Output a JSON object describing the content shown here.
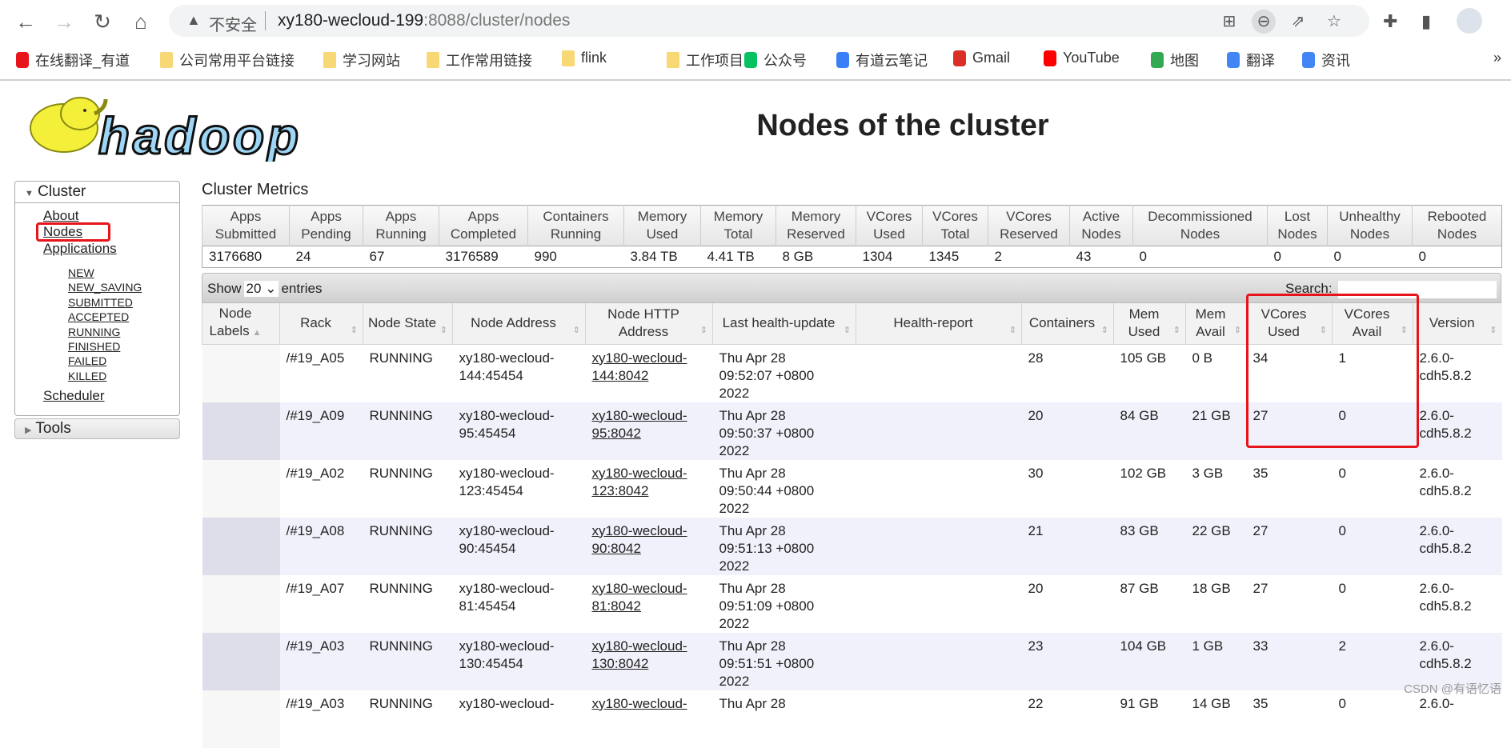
{
  "browser": {
    "insecure_label": "不安全",
    "url_host": "xy180-wecloud-199",
    "url_rest": ":8088/cluster/nodes",
    "bookmarks": [
      {
        "label": "在线翻译_有道",
        "icon": "youdao-icon",
        "color": "#e8141c"
      },
      {
        "label": "公司常用平台链接",
        "icon": "folder-icon",
        "color": "#f8d775"
      },
      {
        "label": "学习网站",
        "icon": "folder-icon",
        "color": "#f8d775"
      },
      {
        "label": "工作常用链接",
        "icon": "folder-icon",
        "color": "#f8d775"
      },
      {
        "label": "flink",
        "icon": "folder-icon",
        "color": "#f8d775"
      },
      {
        "label": "工作项目",
        "icon": "folder-icon",
        "color": "#f8d775"
      },
      {
        "label": "公众号",
        "icon": "wechat-icon",
        "color": "#07c160"
      },
      {
        "label": "有道云笔记",
        "icon": "youdao-note-icon",
        "color": "#3a7ff6"
      },
      {
        "label": "Gmail",
        "icon": "gmail-icon",
        "color": "#d93025"
      },
      {
        "label": "YouTube",
        "icon": "youtube-icon",
        "color": "#ff0000"
      },
      {
        "label": "地图",
        "icon": "maps-icon",
        "color": "#34a853"
      },
      {
        "label": "翻译",
        "icon": "translate-icon",
        "color": "#4285f4"
      },
      {
        "label": "资讯",
        "icon": "news-icon",
        "color": "#4285f4"
      }
    ],
    "more": "»"
  },
  "logo": {
    "text": "hadoop"
  },
  "page_title": "Nodes of the cluster",
  "sidebar": {
    "cluster_label": "Cluster",
    "links": [
      "About",
      "Nodes",
      "Applications"
    ],
    "app_states": [
      "NEW",
      "NEW_SAVING",
      "SUBMITTED",
      "ACCEPTED",
      "RUNNING",
      "FINISHED",
      "FAILED",
      "KILLED"
    ],
    "scheduler": "Scheduler",
    "tools_label": "Tools"
  },
  "metrics": {
    "title": "Cluster Metrics",
    "headers": [
      [
        "Apps",
        "Submitted"
      ],
      [
        "Apps",
        "Pending"
      ],
      [
        "Apps",
        "Running"
      ],
      [
        "Apps",
        "Completed"
      ],
      [
        "Containers",
        "Running"
      ],
      [
        "Memory",
        "Used"
      ],
      [
        "Memory",
        "Total"
      ],
      [
        "Memory",
        "Reserved"
      ],
      [
        "VCores",
        "Used"
      ],
      [
        "VCores",
        "Total"
      ],
      [
        "VCores",
        "Reserved"
      ],
      [
        "Active",
        "Nodes"
      ],
      [
        "Decommissioned",
        "Nodes"
      ],
      [
        "Lost",
        "Nodes"
      ],
      [
        "Unhealthy",
        "Nodes"
      ],
      [
        "Rebooted",
        "Nodes"
      ]
    ],
    "values": [
      "3176680",
      "24",
      "67",
      "3176589",
      "990",
      "3.84 TB",
      "4.41 TB",
      "8 GB",
      "1304",
      "1345",
      "2",
      "43",
      "0",
      "0",
      "0",
      "0"
    ],
    "linked": [
      false,
      false,
      false,
      false,
      false,
      false,
      false,
      false,
      false,
      false,
      false,
      true,
      true,
      true,
      true,
      true
    ]
  },
  "datatable": {
    "show_label": "Show",
    "entries_value": "20",
    "entries_label": "entries",
    "search_label": "Search:",
    "search_value": ""
  },
  "nodes": {
    "headers": [
      [
        "Node",
        "Labels"
      ],
      [
        "Rack"
      ],
      [
        "Node State"
      ],
      [
        "Node Address"
      ],
      [
        "Node HTTP",
        "Address"
      ],
      [
        "Last health-update"
      ],
      [
        "Health-report"
      ],
      [
        "Containers"
      ],
      [
        "Mem",
        "Used"
      ],
      [
        "Mem",
        "Avail"
      ],
      [
        "VCores",
        "Used"
      ],
      [
        "VCores",
        "Avail"
      ],
      [
        "Version"
      ]
    ],
    "sorted_column": "Node Labels",
    "rows": [
      {
        "labels": "",
        "rack": "/#19_A05",
        "state": "RUNNING",
        "address": [
          "xy180-wecloud-",
          "144:45454"
        ],
        "http": [
          "xy180-wecloud-",
          "144:8042"
        ],
        "health_update": [
          "Thu Apr 28",
          "09:52:07 +0800",
          "2022"
        ],
        "health_report": "",
        "containers": "28",
        "mem_used": "105 GB",
        "mem_avail": "0 B",
        "vcores_used": "34",
        "vcores_avail": "1",
        "version": [
          "2.6.0-",
          "cdh5.8.2"
        ]
      },
      {
        "labels": "",
        "rack": "/#19_A09",
        "state": "RUNNING",
        "address": [
          "xy180-wecloud-",
          "95:45454"
        ],
        "http": [
          "xy180-wecloud-",
          "95:8042"
        ],
        "health_update": [
          "Thu Apr 28",
          "09:50:37 +0800",
          "2022"
        ],
        "health_report": "",
        "containers": "20",
        "mem_used": "84 GB",
        "mem_avail": "21 GB",
        "vcores_used": "27",
        "vcores_avail": "0",
        "version": [
          "2.6.0-",
          "cdh5.8.2"
        ]
      },
      {
        "labels": "",
        "rack": "/#19_A02",
        "state": "RUNNING",
        "address": [
          "xy180-wecloud-",
          "123:45454"
        ],
        "http": [
          "xy180-wecloud-",
          "123:8042"
        ],
        "health_update": [
          "Thu Apr 28",
          "09:50:44 +0800",
          "2022"
        ],
        "health_report": "",
        "containers": "30",
        "mem_used": "102 GB",
        "mem_avail": "3 GB",
        "vcores_used": "35",
        "vcores_avail": "0",
        "version": [
          "2.6.0-",
          "cdh5.8.2"
        ]
      },
      {
        "labels": "",
        "rack": "/#19_A08",
        "state": "RUNNING",
        "address": [
          "xy180-wecloud-",
          "90:45454"
        ],
        "http": [
          "xy180-wecloud-",
          "90:8042"
        ],
        "health_update": [
          "Thu Apr 28",
          "09:51:13 +0800",
          "2022"
        ],
        "health_report": "",
        "containers": "21",
        "mem_used": "83 GB",
        "mem_avail": "22 GB",
        "vcores_used": "27",
        "vcores_avail": "0",
        "version": [
          "2.6.0-",
          "cdh5.8.2"
        ]
      },
      {
        "labels": "",
        "rack": "/#19_A07",
        "state": "RUNNING",
        "address": [
          "xy180-wecloud-",
          "81:45454"
        ],
        "http": [
          "xy180-wecloud-",
          "81:8042"
        ],
        "health_update": [
          "Thu Apr 28",
          "09:51:09 +0800",
          "2022"
        ],
        "health_report": "",
        "containers": "20",
        "mem_used": "87 GB",
        "mem_avail": "18 GB",
        "vcores_used": "27",
        "vcores_avail": "0",
        "version": [
          "2.6.0-",
          "cdh5.8.2"
        ]
      },
      {
        "labels": "",
        "rack": "/#19_A03",
        "state": "RUNNING",
        "address": [
          "xy180-wecloud-",
          "130:45454"
        ],
        "http": [
          "xy180-wecloud-",
          "130:8042"
        ],
        "health_update": [
          "Thu Apr 28",
          "09:51:51 +0800",
          "2022"
        ],
        "health_report": "",
        "containers": "23",
        "mem_used": "104 GB",
        "mem_avail": "1 GB",
        "vcores_used": "33",
        "vcores_avail": "2",
        "version": [
          "2.6.0-",
          "cdh5.8.2"
        ]
      },
      {
        "labels": "",
        "rack": "/#19_A03",
        "state": "RUNNING",
        "address": [
          "xy180-wecloud-",
          ""
        ],
        "http": [
          "xy180-wecloud-",
          ""
        ],
        "health_update": [
          "Thu Apr 28",
          "",
          ""
        ],
        "health_report": "",
        "containers": "22",
        "mem_used": "91 GB",
        "mem_avail": "14 GB",
        "vcores_used": "35",
        "vcores_avail": "0",
        "version": [
          "2.6.0-",
          ""
        ]
      }
    ]
  },
  "annotations": {
    "color": "#e8141c"
  },
  "watermark": "CSDN @有语忆语"
}
